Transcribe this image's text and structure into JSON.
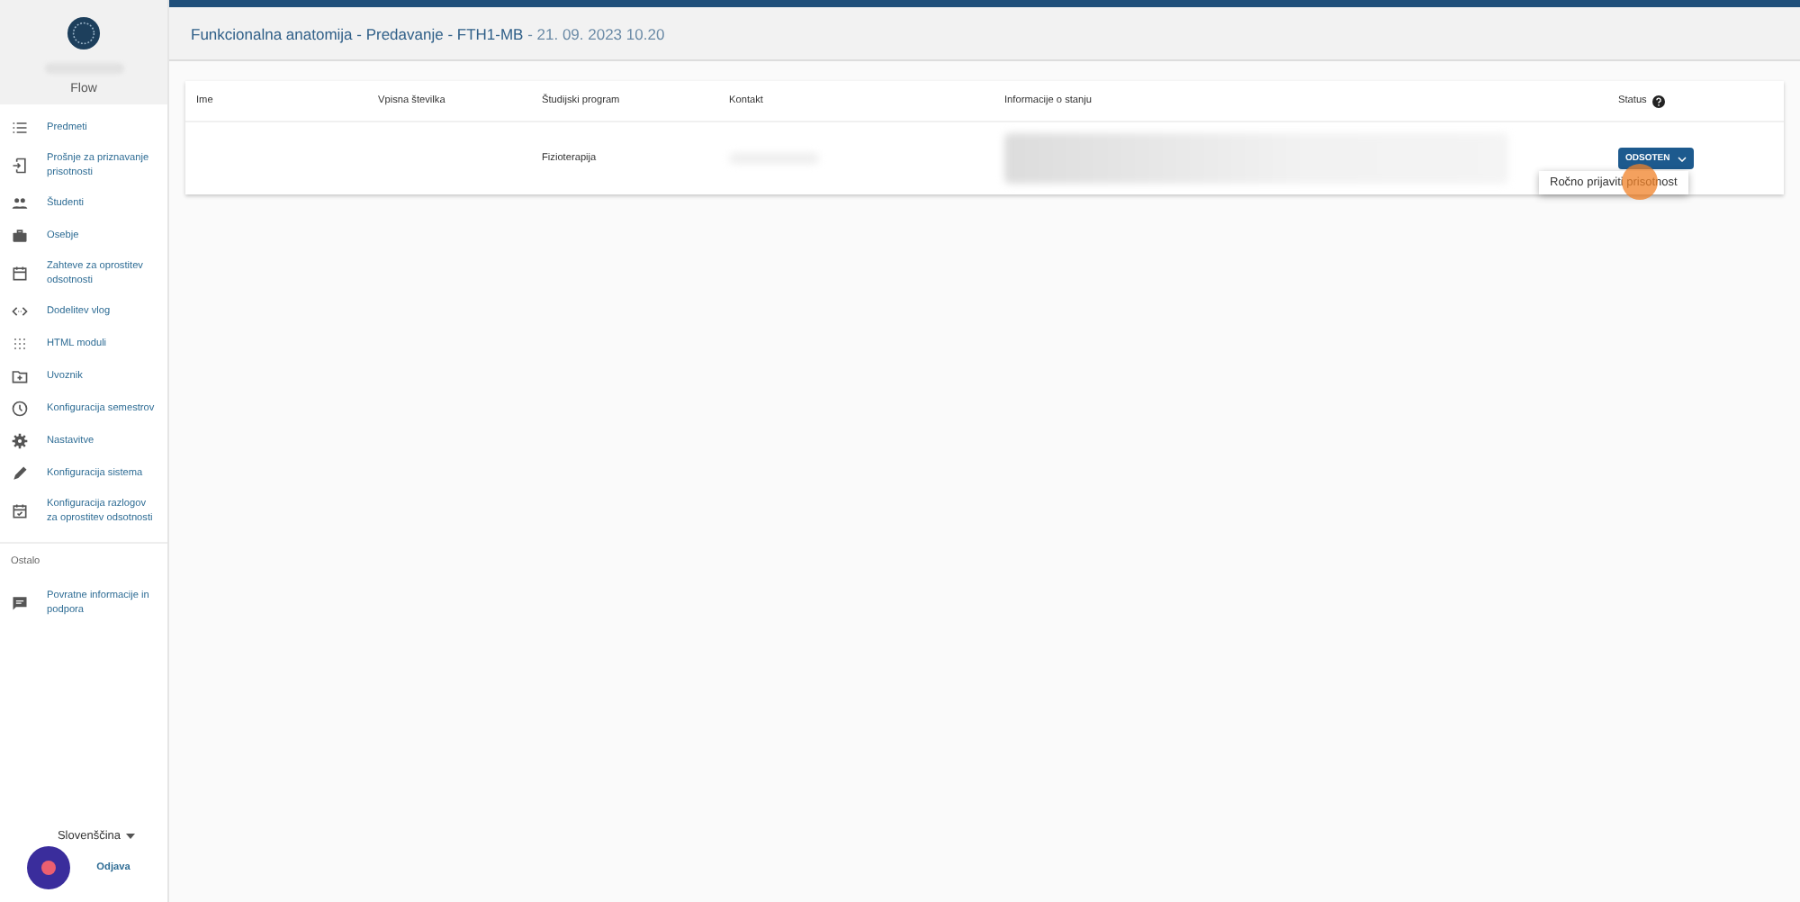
{
  "sidebar": {
    "app_name": "Flow",
    "items": [
      {
        "label": "Predmeti"
      },
      {
        "label": "Prošnje za priznavanje prisotnosti"
      },
      {
        "label": "Študenti"
      },
      {
        "label": "Osebje"
      },
      {
        "label": "Zahteve za oprostitev odsotnosti"
      },
      {
        "label": "Dodelitev vlog"
      },
      {
        "label": "HTML moduli"
      },
      {
        "label": "Uvoznik"
      },
      {
        "label": "Konfiguracija semestrov"
      },
      {
        "label": "Nastavitve"
      },
      {
        "label": "Konfiguracija sistema"
      },
      {
        "label": "Konfiguracija razlogov za oprostitev odsotnosti"
      }
    ],
    "section_title": "Ostalo",
    "other_items": [
      {
        "label": "Povratne informacije in podpora"
      }
    ],
    "language": "Slovenščina",
    "logout": "Odjava"
  },
  "header": {
    "title": "Funkcionalna anatomija - Predavanje - FTH1-MB",
    "date": " - 21. 09. 2023 10.20"
  },
  "table": {
    "columns": [
      "Ime",
      "Vpisna številka",
      "Študijski program",
      "Kontakt",
      "Informacije o stanju",
      "Status"
    ],
    "rows": [
      {
        "program": "Fizioterapija",
        "status": "ODSOTEN"
      }
    ]
  },
  "menu": {
    "items": [
      "Ročno prijaviti prisotnost"
    ]
  }
}
